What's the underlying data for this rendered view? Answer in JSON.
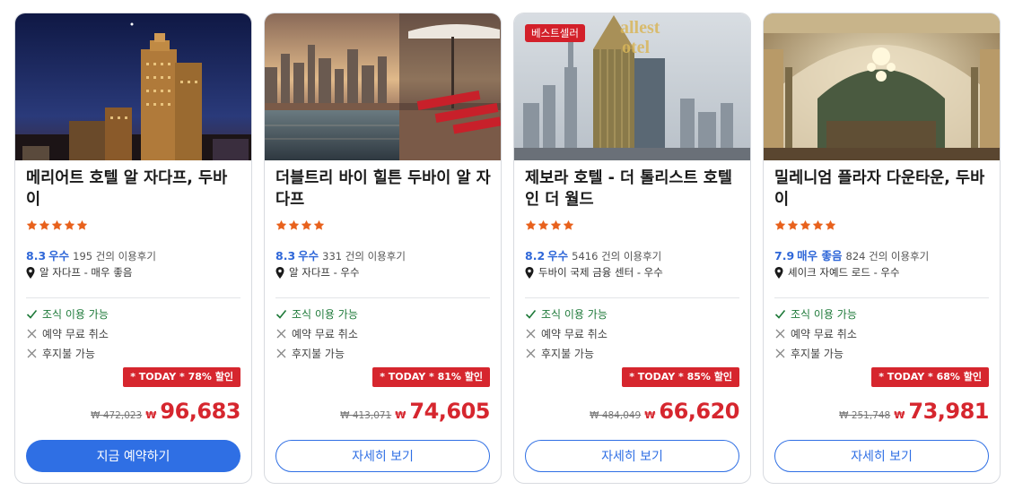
{
  "colors": {
    "accent": "#2f6fe4",
    "rating_blue": "#2f67d8",
    "deal_red": "#d6262e",
    "star_orange": "#e8611c",
    "check_green": "#1f7a3a"
  },
  "hotels": [
    {
      "name": "메리어트 호텔 알 자다프, 두바이",
      "stars": 5,
      "score": "8.3",
      "score_label": "우수",
      "reviews": "195 건의 이용후기",
      "location": "알 자다프 - 매우 좋음",
      "features": [
        "조식 이용 가능",
        "예약 무료 취소",
        "후지불 가능"
      ],
      "deal": "* TODAY * 78% 할인",
      "old_price": "₩ 472,023",
      "currency": "₩",
      "price": "96,683",
      "button": "지금 예약하기",
      "image": "night-city-hotel-photo"
    },
    {
      "name": "더블트리 바이 힐튼 두바이 알 자다프",
      "stars": 4,
      "score": "8.3",
      "score_label": "우수",
      "reviews": "331 건의 이용후기",
      "location": "알 자다프 - 우수",
      "features": [
        "조식 이용 가능",
        "예약 무료 취소",
        "후지불 가능"
      ],
      "deal": "* TODAY * 81% 할인",
      "old_price": "₩ 413,071",
      "currency": "₩",
      "price": "74,605",
      "button": "자세히 보기",
      "image": "rooftop-pool-photo"
    },
    {
      "name": "제보라 호텔 - 더 톨리스트 호텔 인 더 월드",
      "stars": 4,
      "score": "8.2",
      "score_label": "우수",
      "reviews": "5416 건의 이용후기",
      "location": "두바이 국제 금융 센터 - 우수",
      "features": [
        "조식 이용 가능",
        "예약 무료 취소",
        "후지불 가능"
      ],
      "deal": "* TODAY * 85% 할인",
      "old_price": "₩ 484,049",
      "currency": "₩",
      "price": "66,620",
      "button": "자세히 보기",
      "badge": "베스트셀러",
      "image": "tall-tower-photo"
    },
    {
      "name": "밀레니엄 플라자 다운타운, 두바이",
      "stars": 5,
      "score": "7.9",
      "score_label": "매우 좋음",
      "reviews": "824 건의 이용후기",
      "location": "셰이크 자예드 로드 - 우수",
      "features": [
        "조식 이용 가능",
        "예약 무료 취소",
        "후지불 가능"
      ],
      "deal": "* TODAY * 68% 할인",
      "old_price": "₩ 251,748",
      "currency": "₩",
      "price": "73,981",
      "button": "자세히 보기",
      "image": "grand-lobby-photo"
    }
  ]
}
